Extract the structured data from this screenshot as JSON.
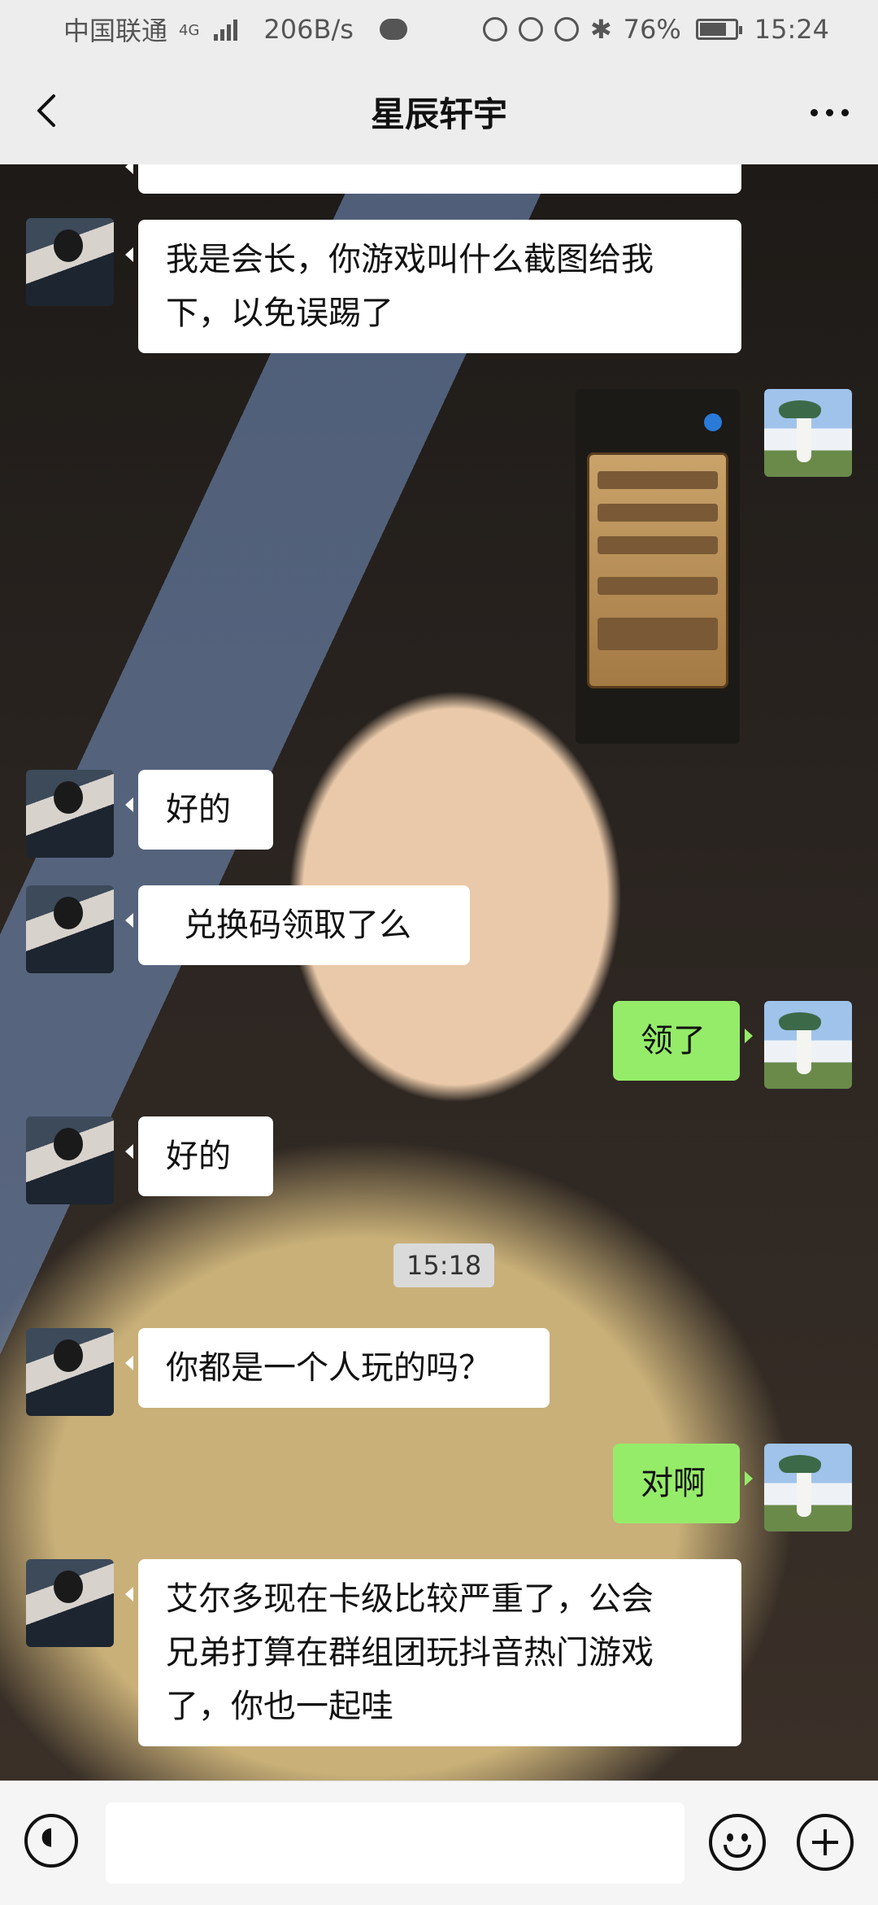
{
  "status_bar": {
    "carrier": "中国联通",
    "network": "4G",
    "speed": "206B/s",
    "battery": "76%",
    "battery_level": 0.76,
    "time": "15:24"
  },
  "header": {
    "title": "星辰轩宇",
    "back_icon": "chevron-left-icon",
    "more_icon": "more-dots-icon"
  },
  "messages": [
    {
      "side": "in",
      "text_line1": "我是会长，你游戏叫什么截图给我",
      "text_line2": "下，以免误踢了"
    },
    {
      "side": "out",
      "type": "image",
      "description": "game-screenshot"
    },
    {
      "side": "in",
      "text": "好的"
    },
    {
      "side": "in",
      "text": "兑换码领取了么"
    },
    {
      "side": "out",
      "text": "领了"
    },
    {
      "side": "in",
      "text": "好的"
    },
    {
      "side": "out",
      "text": "对啊"
    },
    {
      "side": "in",
      "text": "你都是一个人玩的吗？"
    },
    {
      "side": "in",
      "text_line1": "艾尔多现在卡级比较严重了，公会",
      "text_line2": "兄弟打算在群组团玩抖音热门游戏",
      "text_line3": "了，你也一起哇"
    }
  ],
  "timestamp": "15:18",
  "input_bar": {
    "voice_icon": "voice-icon",
    "emoji_icon": "emoji-icon",
    "plus_icon": "plus-icon"
  },
  "colors": {
    "bar_bg": "#ededed",
    "bubble_in": "#ffffff",
    "bubble_out": "#95ec69"
  }
}
